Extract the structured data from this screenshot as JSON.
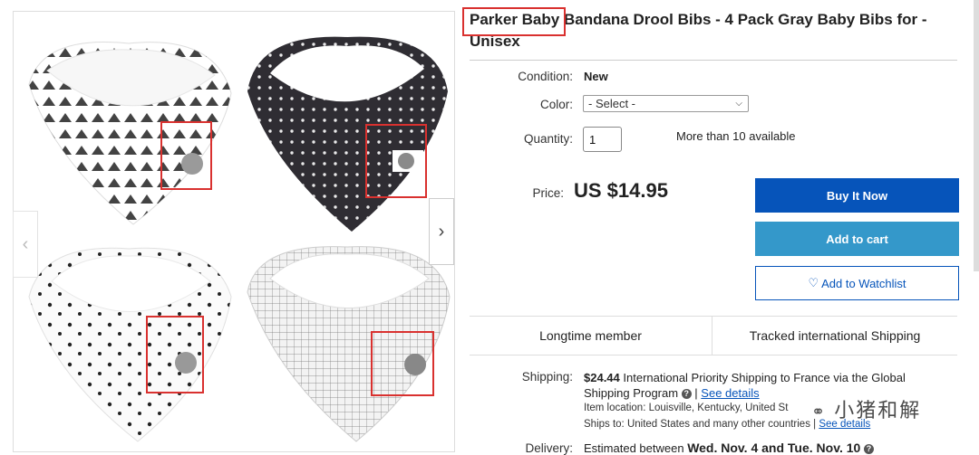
{
  "listing": {
    "title_brand": "Parker Baby",
    "title_rest": " Bandana Drool Bibs - 4 Pack Gray Baby Bibs for - Unisex"
  },
  "details": {
    "condition_label": "Condition:",
    "condition_value": "New",
    "color_label": "Color:",
    "color_selected": "- Select -",
    "quantity_label": "Quantity:",
    "quantity_value": "1",
    "availability": "More than 10 available"
  },
  "pricing": {
    "price_label": "Price:",
    "price_value": "US $14.95"
  },
  "actions": {
    "buy_now": "Buy It Now",
    "add_to_cart": "Add to cart",
    "add_to_watchlist": "Add to Watchlist"
  },
  "features": {
    "left": "Longtime member",
    "right": "Tracked international Shipping"
  },
  "shipping": {
    "label": "Shipping:",
    "cost": "$24.44",
    "method": "International Priority Shipping to France  via the Global",
    "program": "Shipping Program",
    "see_details": "See details",
    "location": "Item location: Louisville, Kentucky, United St",
    "ships_to": "Ships to: United States and many other countries",
    "see_details_2": "See details"
  },
  "delivery": {
    "label": "Delivery:",
    "text_prefix": "Estimated between ",
    "dates": "Wed. Nov. 4 and Tue. Nov. 10"
  },
  "watermark": "小猪和解",
  "colors": {
    "buy_now": "#0654ba",
    "add_to_cart": "#3498ca",
    "highlight": "#d9312f"
  }
}
